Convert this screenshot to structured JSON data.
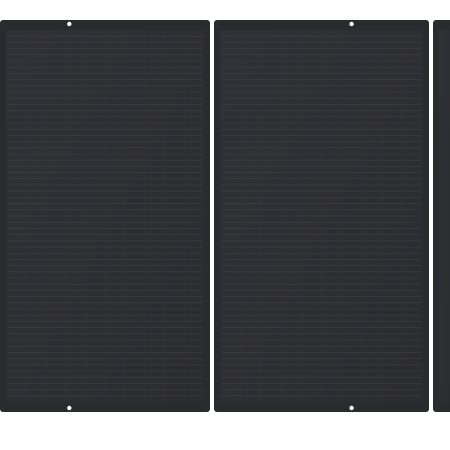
{
  "product": {
    "kind": "folding solar panel",
    "panel_count_visible": 3,
    "colors": {
      "background": "#ffffff",
      "panel_frame": "#2a2b2f",
      "panel_surface": "#333438",
      "cell_line": "#45464b",
      "grommet": "#ffffff"
    }
  }
}
